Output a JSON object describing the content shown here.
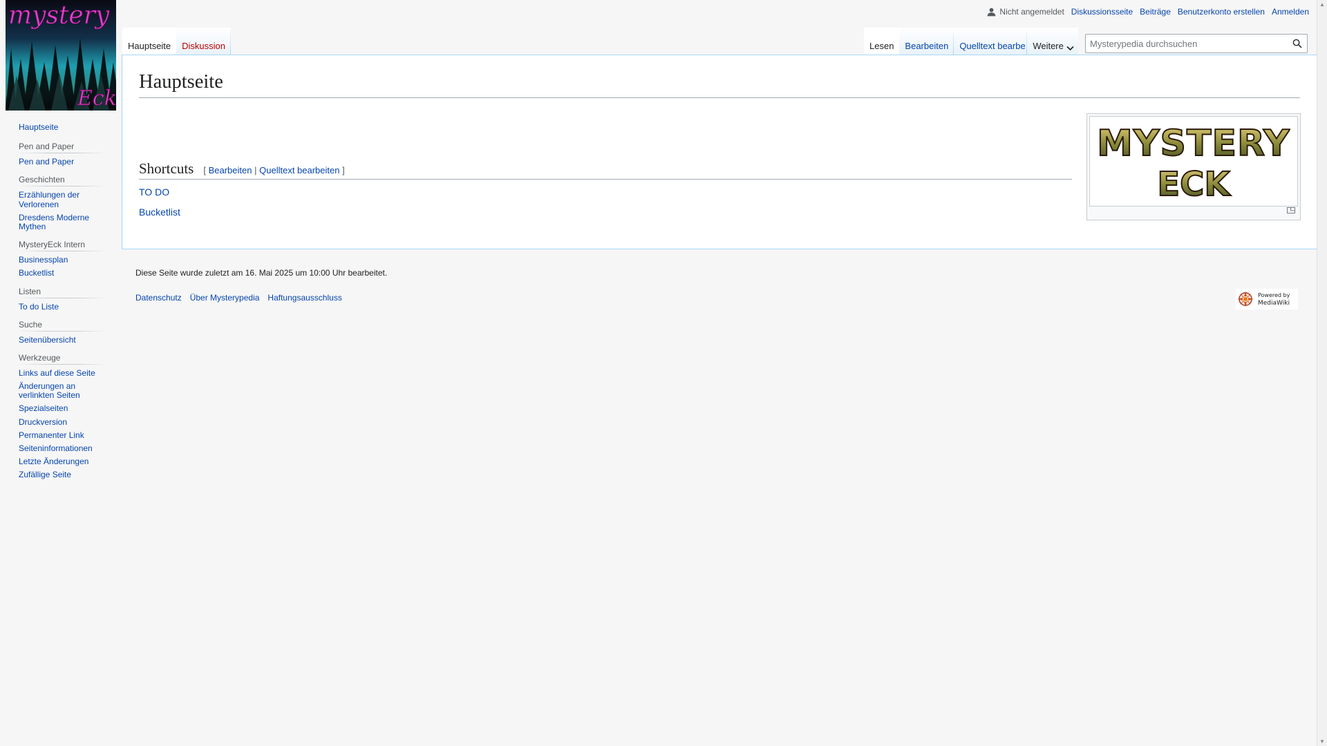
{
  "logo": {
    "alt": "mystery Eck",
    "text_top": "mystery",
    "text_bottom": "Eck"
  },
  "personal": {
    "anon": "Nicht angemeldet",
    "links": [
      "Diskussionsseite",
      "Beiträge",
      "Benutzerkonto erstellen",
      "Anmelden"
    ]
  },
  "tabs": {
    "left": [
      {
        "label": "Hauptseite",
        "selected": true
      },
      {
        "label": "Diskussion",
        "selected": false
      }
    ],
    "right": [
      {
        "label": "Lesen",
        "selected": true
      },
      {
        "label": "Bearbeiten"
      },
      {
        "label": "Quelltext bearbe"
      }
    ],
    "more": "Weitere"
  },
  "search": {
    "placeholder": "Mysterypedia durchsuchen"
  },
  "page": {
    "title": "Hauptseite",
    "section_heading": "Shortcuts",
    "edit_open": "[",
    "edit_link": "Bearbeiten",
    "edit_sep": "|",
    "source_link": "Quelltext bearbeiten",
    "edit_close": "]",
    "links": [
      "TO DO",
      "Bucketlist"
    ],
    "image_text": [
      "MYSTERY",
      "ECK"
    ]
  },
  "sidebar": {
    "main": [
      "Hauptseite"
    ],
    "portals": [
      {
        "heading": "Pen and Paper",
        "items": [
          "Pen and Paper"
        ]
      },
      {
        "heading": "Geschichten",
        "items": [
          "Erzählungen der Verlorenen",
          "Dresdens Moderne Mythen"
        ]
      },
      {
        "heading": "MysteryEck Intern",
        "items": [
          "Businessplan",
          "Bucketlist"
        ]
      },
      {
        "heading": "Listen",
        "items": [
          "To do Liste"
        ]
      },
      {
        "heading": "Suche",
        "items": [
          "Seitenübersicht"
        ]
      },
      {
        "heading": "Werkzeuge",
        "items": [
          "Links auf diese Seite",
          "Änderungen an verlinkten Seiten",
          "Spezialseiten",
          "Druckversion",
          "Permanenter Link",
          "Seiteninformationen",
          "Letzte Änderungen",
          "Zufällige Seite"
        ]
      }
    ]
  },
  "footer": {
    "lastmod": "Diese Seite wurde zuletzt am 16. Mai 2025 um 10:00 Uhr bearbeitet.",
    "places": [
      "Datenschutz",
      "Über Mysterypedia",
      "Haftungsausschluss"
    ],
    "powered_line1": "Powered by",
    "powered_line2": "MediaWiki"
  },
  "colors": {
    "link": "#0645ad",
    "new_link": "#ba0000",
    "border": "#a7d7f9"
  }
}
